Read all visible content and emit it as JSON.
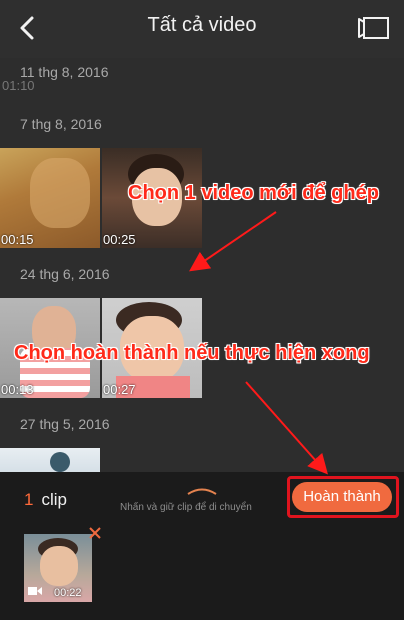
{
  "header": {
    "title": "Tất cả video",
    "back_icon": "chevron-left-icon",
    "camera_icon": "video-camera-icon"
  },
  "ghost_duration": "01:10",
  "groups": [
    {
      "date": "11 thg 8, 2016",
      "thumbs": []
    },
    {
      "date": "7 thg 8, 2016",
      "thumbs": [
        {
          "duration": "00:15"
        },
        {
          "duration": "00:25"
        }
      ]
    },
    {
      "date": "24 thg 6, 2016",
      "thumbs": [
        {
          "duration": "00:13"
        },
        {
          "duration": "00:27"
        }
      ]
    },
    {
      "date": "27 thg 5, 2016",
      "thumbs": [
        {
          "duration": ""
        }
      ]
    }
  ],
  "panel": {
    "clip_count": "1",
    "clip_word": "clip",
    "hint": "Nhấn và giữ clip để di chuyển",
    "done_label": "Hoàn thành",
    "selected_clip_duration": "00:22",
    "remove_icon": "close-icon"
  },
  "annotations": {
    "pick_video": "Chọn 1 video mới để ghép",
    "pick_done": "Chọn hoàn thành nếu thực hiện xong"
  },
  "colors": {
    "accent": "#f06a3f",
    "annotation": "#ff2a1a",
    "background": "#2b2b2b"
  }
}
